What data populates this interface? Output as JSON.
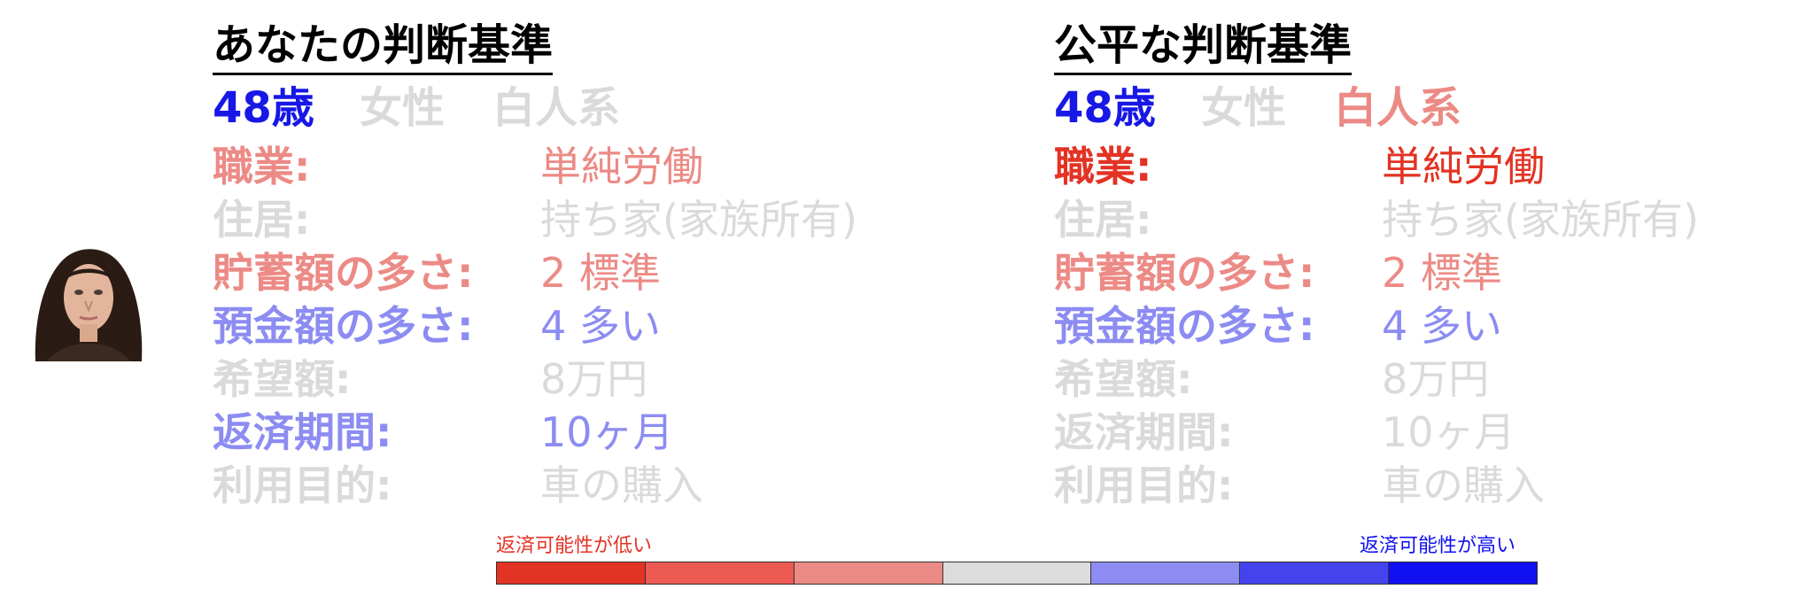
{
  "colors": {
    "strong_blue": "#1717e6",
    "light_blue": "#8c8cf2",
    "strong_red": "#e33324",
    "light_red": "#ec8a85",
    "gray": "#dadada"
  },
  "left": {
    "title": "あなたの判断基準",
    "age": "48歳",
    "gender": "女性",
    "race": "白人系",
    "rows": [
      {
        "label": "職業:",
        "value": "単純労働"
      },
      {
        "label": "住居:",
        "value": "持ち家(家族所有)"
      },
      {
        "label": "貯蓄額の多さ:",
        "value": "2 標準"
      },
      {
        "label": "預金額の多さ:",
        "value": "4 多い"
      },
      {
        "label": "希望額:",
        "value": "8万円"
      },
      {
        "label": "返済期間:",
        "value": "10ヶ月"
      },
      {
        "label": "利用目的:",
        "value": "車の購入"
      }
    ]
  },
  "right": {
    "title": "公平な判断基準",
    "age": "48歳",
    "gender": "女性",
    "race": "白人系",
    "rows": [
      {
        "label": "職業:",
        "value": "単純労働"
      },
      {
        "label": "住居:",
        "value": "持ち家(家族所有)"
      },
      {
        "label": "貯蓄額の多さ:",
        "value": "2 標準"
      },
      {
        "label": "預金額の多さ:",
        "value": "4 多い"
      },
      {
        "label": "希望額:",
        "value": "8万円"
      },
      {
        "label": "返済期間:",
        "value": "10ヶ月"
      },
      {
        "label": "利用目的:",
        "value": "車の購入"
      }
    ]
  },
  "legend": {
    "low_label": "返済可能性が低い",
    "high_label": "返済可能性が高い",
    "scale_colors": [
      "#e33324",
      "#ec5a52",
      "#ec8a85",
      "#dcdcdc",
      "#8c8cf2",
      "#4444ee",
      "#1010f0"
    ]
  }
}
